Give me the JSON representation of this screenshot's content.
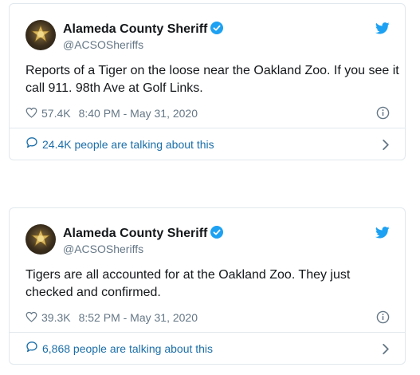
{
  "tweets": [
    {
      "author": {
        "name": "Alameda County Sheriff",
        "handle": "@ACSOSheriffs",
        "verified": true
      },
      "text": "Reports of a Tiger on the loose near the Oakland Zoo. If you see it call 911. 98th Ave at Golf Links.",
      "likes": "57.4K",
      "timestamp": "8:40 PM - May 31, 2020",
      "talking": "24.4K people are talking about this"
    },
    {
      "author": {
        "name": "Alameda County Sheriff",
        "handle": "@ACSOSheriffs",
        "verified": true
      },
      "text": "Tigers are all accounted for at the Oakland Zoo. They just checked and confirmed.",
      "likes": "39.3K",
      "timestamp": "8:52 PM - May 31, 2020",
      "talking": "6,868 people are talking about this"
    }
  ],
  "icons": {
    "verified": "verified-badge-icon",
    "brand": "twitter-bird-icon",
    "like": "heart-icon",
    "info": "info-icon",
    "comment": "comment-icon",
    "chevron": "chevron-right-icon"
  },
  "colors": {
    "twitter_blue": "#1da1f2",
    "link_blue": "#1b6ea8",
    "secondary_text": "#657786",
    "border": "#e1e8ed",
    "primary_text": "#14171a"
  }
}
